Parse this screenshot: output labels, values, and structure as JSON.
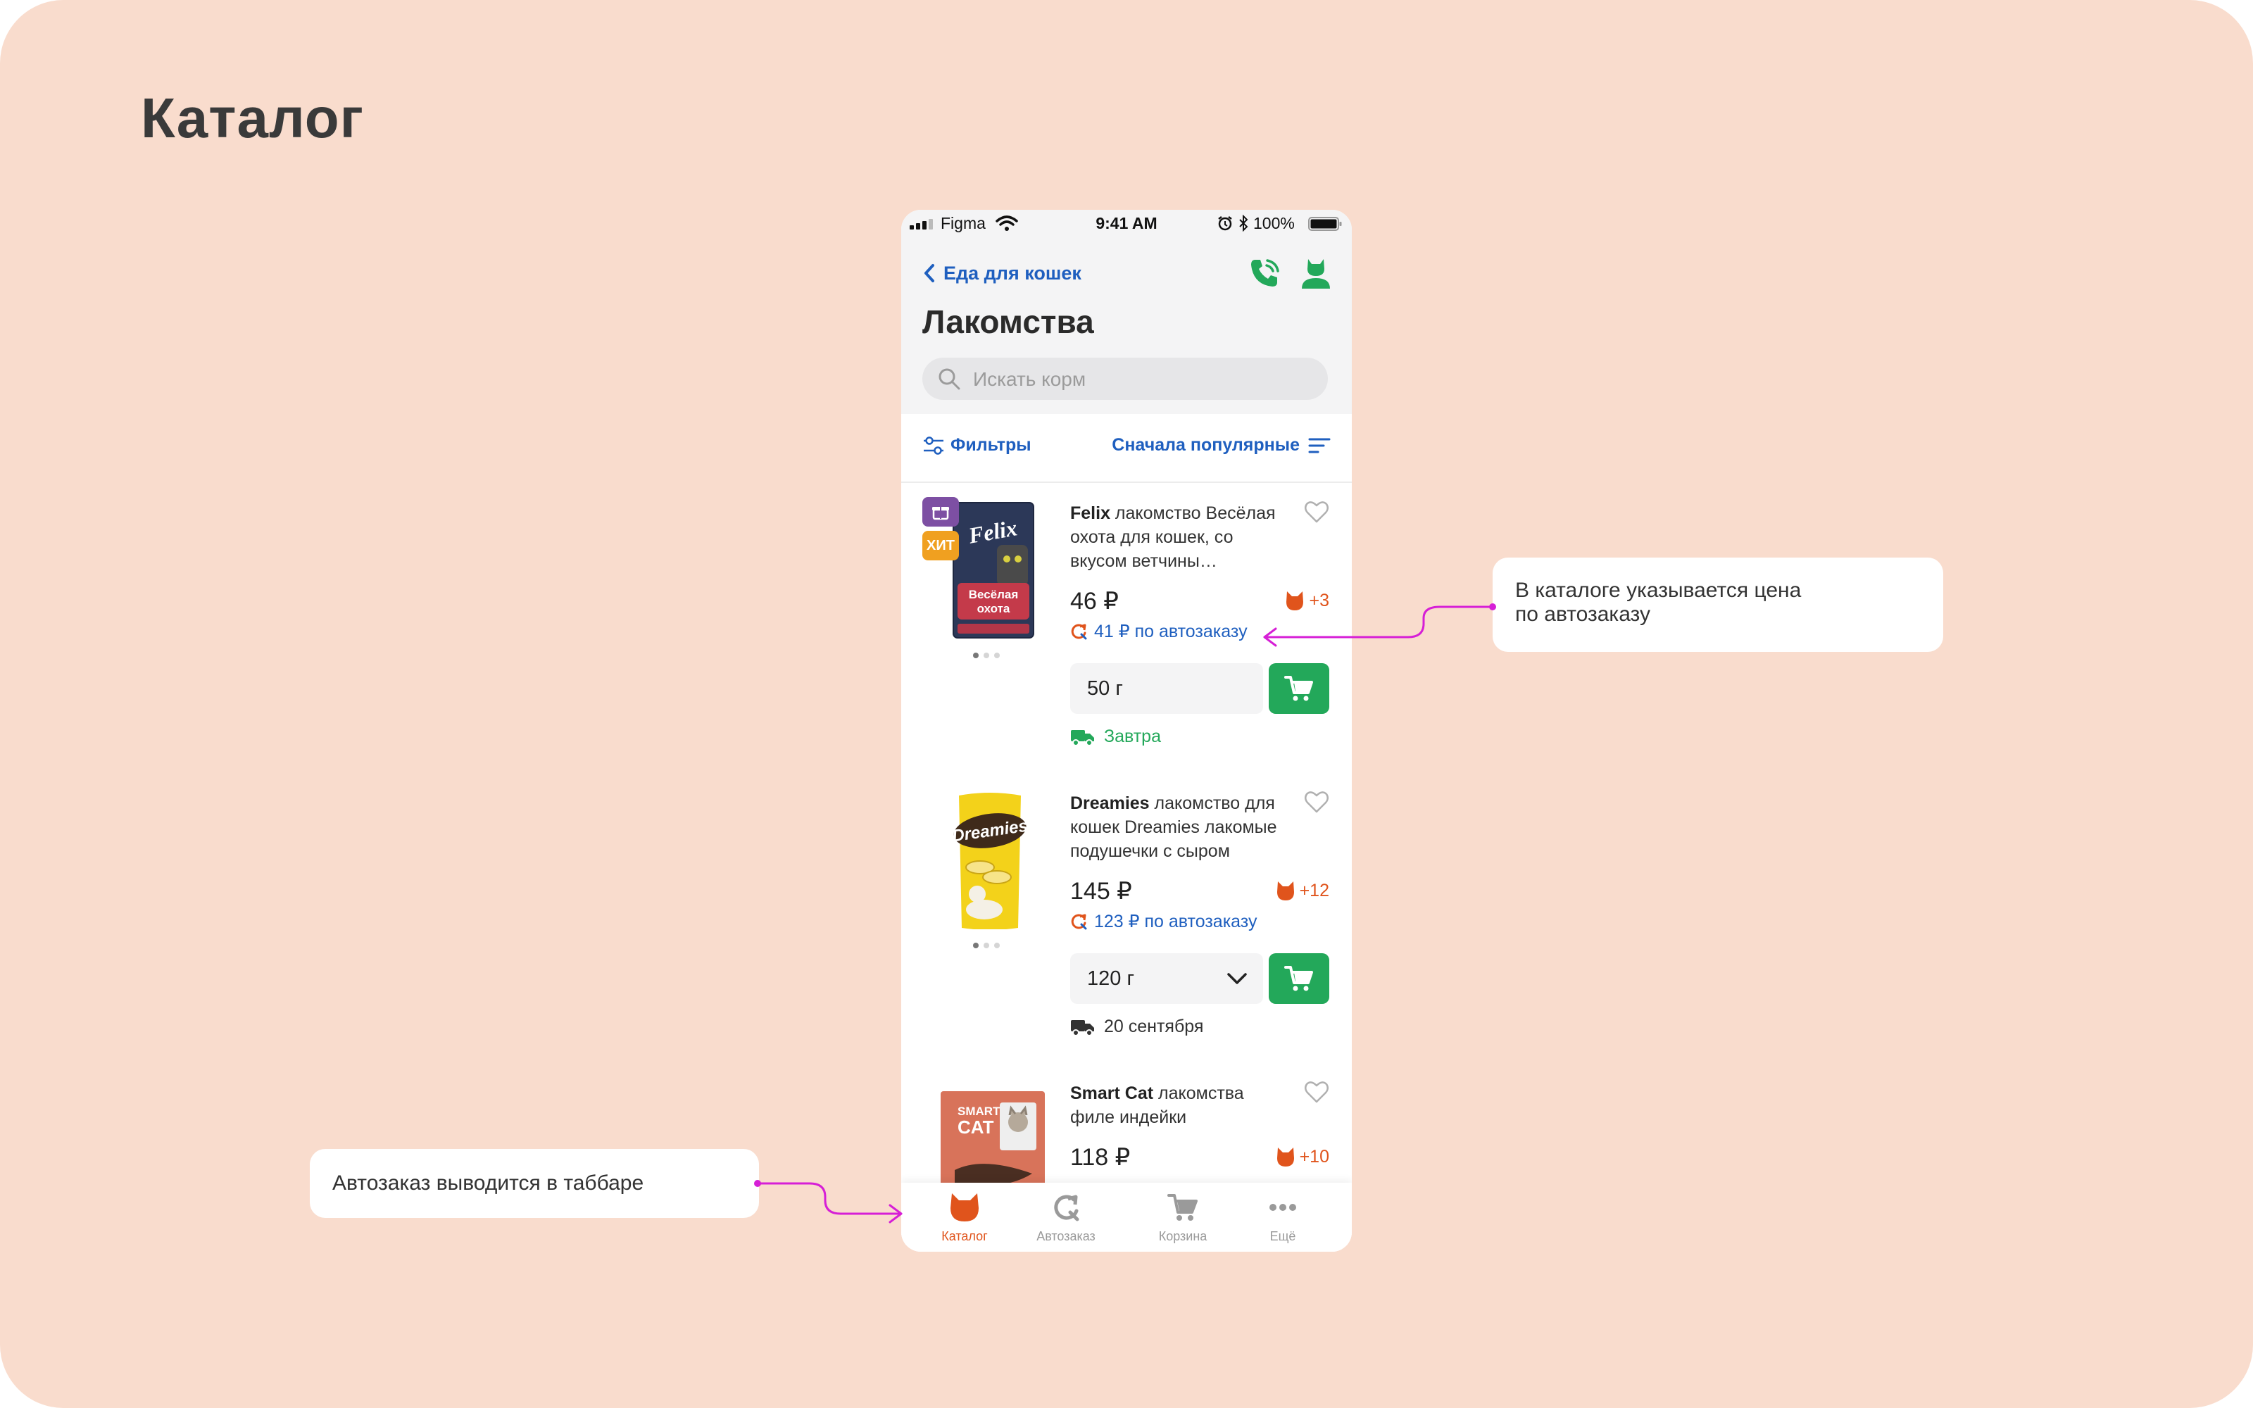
{
  "page_heading": "Каталог",
  "colors": {
    "background": "#f9dccd",
    "brand_blue": "#1f5fbf",
    "brand_green": "#23a85a",
    "accent_orange": "#e0541c",
    "annotation_magenta": "#d61fd6"
  },
  "phone": {
    "status_bar": {
      "carrier": "Figma",
      "time": "9:41 AM",
      "battery": "100%"
    },
    "nav": {
      "back_label": "Еда для кошек",
      "icons": [
        "call-icon",
        "profile-icon"
      ]
    },
    "title": "Лакомства",
    "search": {
      "placeholder": "Искать корм",
      "value": ""
    },
    "filters_label": "Фильтры",
    "sort_label": "Сначала популярные",
    "products": [
      {
        "brand": "Felix",
        "name_rest": " лакомство Весёлая охота для кошек, со вкусом ветчины…",
        "badges": [
          "gift-icon",
          "ХИТ"
        ],
        "price": "46 ₽",
        "bonus": "+3",
        "autoorder_price": "41 ₽ по автозаказу",
        "weight": "50 г",
        "delivery": "Завтра",
        "delivery_color": "#23a85a"
      },
      {
        "brand": "Dreamies",
        "name_rest": " лакомство для кошек Dreamies лакомые подушечки с сыром",
        "price": "145 ₽",
        "bonus": "+12",
        "autoorder_price": "123 ₽ по автозаказу",
        "weight": "120 г",
        "weight_has_dropdown": true,
        "delivery": "20 сентября",
        "delivery_color": "#333333"
      },
      {
        "brand": "Smart Cat",
        "name_rest": " лакомства филе индейки",
        "price": "118 ₽",
        "bonus": "+10"
      }
    ],
    "tabbar": [
      {
        "label": "Каталог",
        "icon": "cat-icon",
        "active": true
      },
      {
        "label": "Автозаказ",
        "icon": "autoorder-icon",
        "active": false
      },
      {
        "label": "Корзина",
        "icon": "cart-icon",
        "active": false
      },
      {
        "label": "Ещё",
        "icon": "more-icon",
        "active": false
      }
    ]
  },
  "annotations": {
    "autoorder_price_note": [
      "В каталоге указывается цена",
      "по автозаказу"
    ],
    "tabbar_note": "Автозаказ выводится в таббаре"
  }
}
